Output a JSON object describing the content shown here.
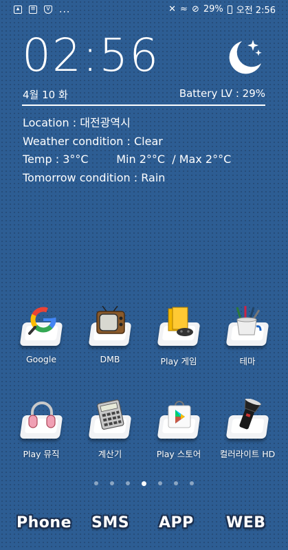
{
  "status_bar": {
    "battery_percent": "29%",
    "time": "오전 2:56",
    "more": "...",
    "left_icons": [
      "gallery-icon",
      "notification-icon",
      "shield-icon"
    ],
    "right_icons": [
      "mute-icon",
      "wifi-icon",
      "do-not-disturb-icon",
      "battery-icon"
    ]
  },
  "widget": {
    "clock": "02:56",
    "date": "4월 10 화",
    "battery": "Battery LV : 29%",
    "weather_icon": "moon-stars-icon",
    "location": "Location : 대전광역시",
    "condition": "Weather condition : Clear",
    "temp": "Temp : 3°°C        Min 2°°C  / Max 2°°C",
    "tomorrow": "Tomorrow condition : Rain"
  },
  "apps": [
    {
      "label": "Google",
      "icon": "google-icon"
    },
    {
      "label": "DMB",
      "icon": "tv-icon"
    },
    {
      "label": "Play 게임",
      "icon": "gamepad-icon"
    },
    {
      "label": "테마",
      "icon": "paint-brushes-icon"
    },
    {
      "label": "Play 뮤직",
      "icon": "headphones-icon"
    },
    {
      "label": "계산기",
      "icon": "calculator-icon"
    },
    {
      "label": "Play 스토어",
      "icon": "play-store-icon"
    },
    {
      "label": "컬러라이트 HD",
      "icon": "flashlight-icon"
    }
  ],
  "pager": {
    "count": 7,
    "active_index": 3
  },
  "dock": {
    "phone": "Phone",
    "sms": "SMS",
    "app": "APP",
    "web": "WEB"
  }
}
